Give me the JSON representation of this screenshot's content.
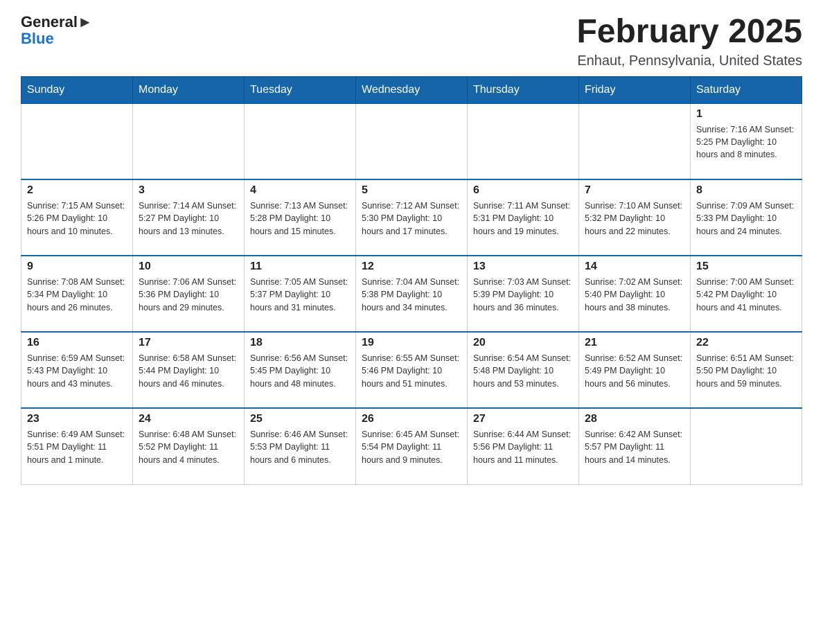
{
  "header": {
    "logo_general": "General",
    "logo_blue": "Blue",
    "month_title": "February 2025",
    "location": "Enhaut, Pennsylvania, United States"
  },
  "weekdays": [
    "Sunday",
    "Monday",
    "Tuesday",
    "Wednesday",
    "Thursday",
    "Friday",
    "Saturday"
  ],
  "weeks": [
    [
      {
        "day": "",
        "info": ""
      },
      {
        "day": "",
        "info": ""
      },
      {
        "day": "",
        "info": ""
      },
      {
        "day": "",
        "info": ""
      },
      {
        "day": "",
        "info": ""
      },
      {
        "day": "",
        "info": ""
      },
      {
        "day": "1",
        "info": "Sunrise: 7:16 AM\nSunset: 5:25 PM\nDaylight: 10 hours\nand 8 minutes."
      }
    ],
    [
      {
        "day": "2",
        "info": "Sunrise: 7:15 AM\nSunset: 5:26 PM\nDaylight: 10 hours\nand 10 minutes."
      },
      {
        "day": "3",
        "info": "Sunrise: 7:14 AM\nSunset: 5:27 PM\nDaylight: 10 hours\nand 13 minutes."
      },
      {
        "day": "4",
        "info": "Sunrise: 7:13 AM\nSunset: 5:28 PM\nDaylight: 10 hours\nand 15 minutes."
      },
      {
        "day": "5",
        "info": "Sunrise: 7:12 AM\nSunset: 5:30 PM\nDaylight: 10 hours\nand 17 minutes."
      },
      {
        "day": "6",
        "info": "Sunrise: 7:11 AM\nSunset: 5:31 PM\nDaylight: 10 hours\nand 19 minutes."
      },
      {
        "day": "7",
        "info": "Sunrise: 7:10 AM\nSunset: 5:32 PM\nDaylight: 10 hours\nand 22 minutes."
      },
      {
        "day": "8",
        "info": "Sunrise: 7:09 AM\nSunset: 5:33 PM\nDaylight: 10 hours\nand 24 minutes."
      }
    ],
    [
      {
        "day": "9",
        "info": "Sunrise: 7:08 AM\nSunset: 5:34 PM\nDaylight: 10 hours\nand 26 minutes."
      },
      {
        "day": "10",
        "info": "Sunrise: 7:06 AM\nSunset: 5:36 PM\nDaylight: 10 hours\nand 29 minutes."
      },
      {
        "day": "11",
        "info": "Sunrise: 7:05 AM\nSunset: 5:37 PM\nDaylight: 10 hours\nand 31 minutes."
      },
      {
        "day": "12",
        "info": "Sunrise: 7:04 AM\nSunset: 5:38 PM\nDaylight: 10 hours\nand 34 minutes."
      },
      {
        "day": "13",
        "info": "Sunrise: 7:03 AM\nSunset: 5:39 PM\nDaylight: 10 hours\nand 36 minutes."
      },
      {
        "day": "14",
        "info": "Sunrise: 7:02 AM\nSunset: 5:40 PM\nDaylight: 10 hours\nand 38 minutes."
      },
      {
        "day": "15",
        "info": "Sunrise: 7:00 AM\nSunset: 5:42 PM\nDaylight: 10 hours\nand 41 minutes."
      }
    ],
    [
      {
        "day": "16",
        "info": "Sunrise: 6:59 AM\nSunset: 5:43 PM\nDaylight: 10 hours\nand 43 minutes."
      },
      {
        "day": "17",
        "info": "Sunrise: 6:58 AM\nSunset: 5:44 PM\nDaylight: 10 hours\nand 46 minutes."
      },
      {
        "day": "18",
        "info": "Sunrise: 6:56 AM\nSunset: 5:45 PM\nDaylight: 10 hours\nand 48 minutes."
      },
      {
        "day": "19",
        "info": "Sunrise: 6:55 AM\nSunset: 5:46 PM\nDaylight: 10 hours\nand 51 minutes."
      },
      {
        "day": "20",
        "info": "Sunrise: 6:54 AM\nSunset: 5:48 PM\nDaylight: 10 hours\nand 53 minutes."
      },
      {
        "day": "21",
        "info": "Sunrise: 6:52 AM\nSunset: 5:49 PM\nDaylight: 10 hours\nand 56 minutes."
      },
      {
        "day": "22",
        "info": "Sunrise: 6:51 AM\nSunset: 5:50 PM\nDaylight: 10 hours\nand 59 minutes."
      }
    ],
    [
      {
        "day": "23",
        "info": "Sunrise: 6:49 AM\nSunset: 5:51 PM\nDaylight: 11 hours\nand 1 minute."
      },
      {
        "day": "24",
        "info": "Sunrise: 6:48 AM\nSunset: 5:52 PM\nDaylight: 11 hours\nand 4 minutes."
      },
      {
        "day": "25",
        "info": "Sunrise: 6:46 AM\nSunset: 5:53 PM\nDaylight: 11 hours\nand 6 minutes."
      },
      {
        "day": "26",
        "info": "Sunrise: 6:45 AM\nSunset: 5:54 PM\nDaylight: 11 hours\nand 9 minutes."
      },
      {
        "day": "27",
        "info": "Sunrise: 6:44 AM\nSunset: 5:56 PM\nDaylight: 11 hours\nand 11 minutes."
      },
      {
        "day": "28",
        "info": "Sunrise: 6:42 AM\nSunset: 5:57 PM\nDaylight: 11 hours\nand 14 minutes."
      },
      {
        "day": "",
        "info": ""
      }
    ]
  ]
}
